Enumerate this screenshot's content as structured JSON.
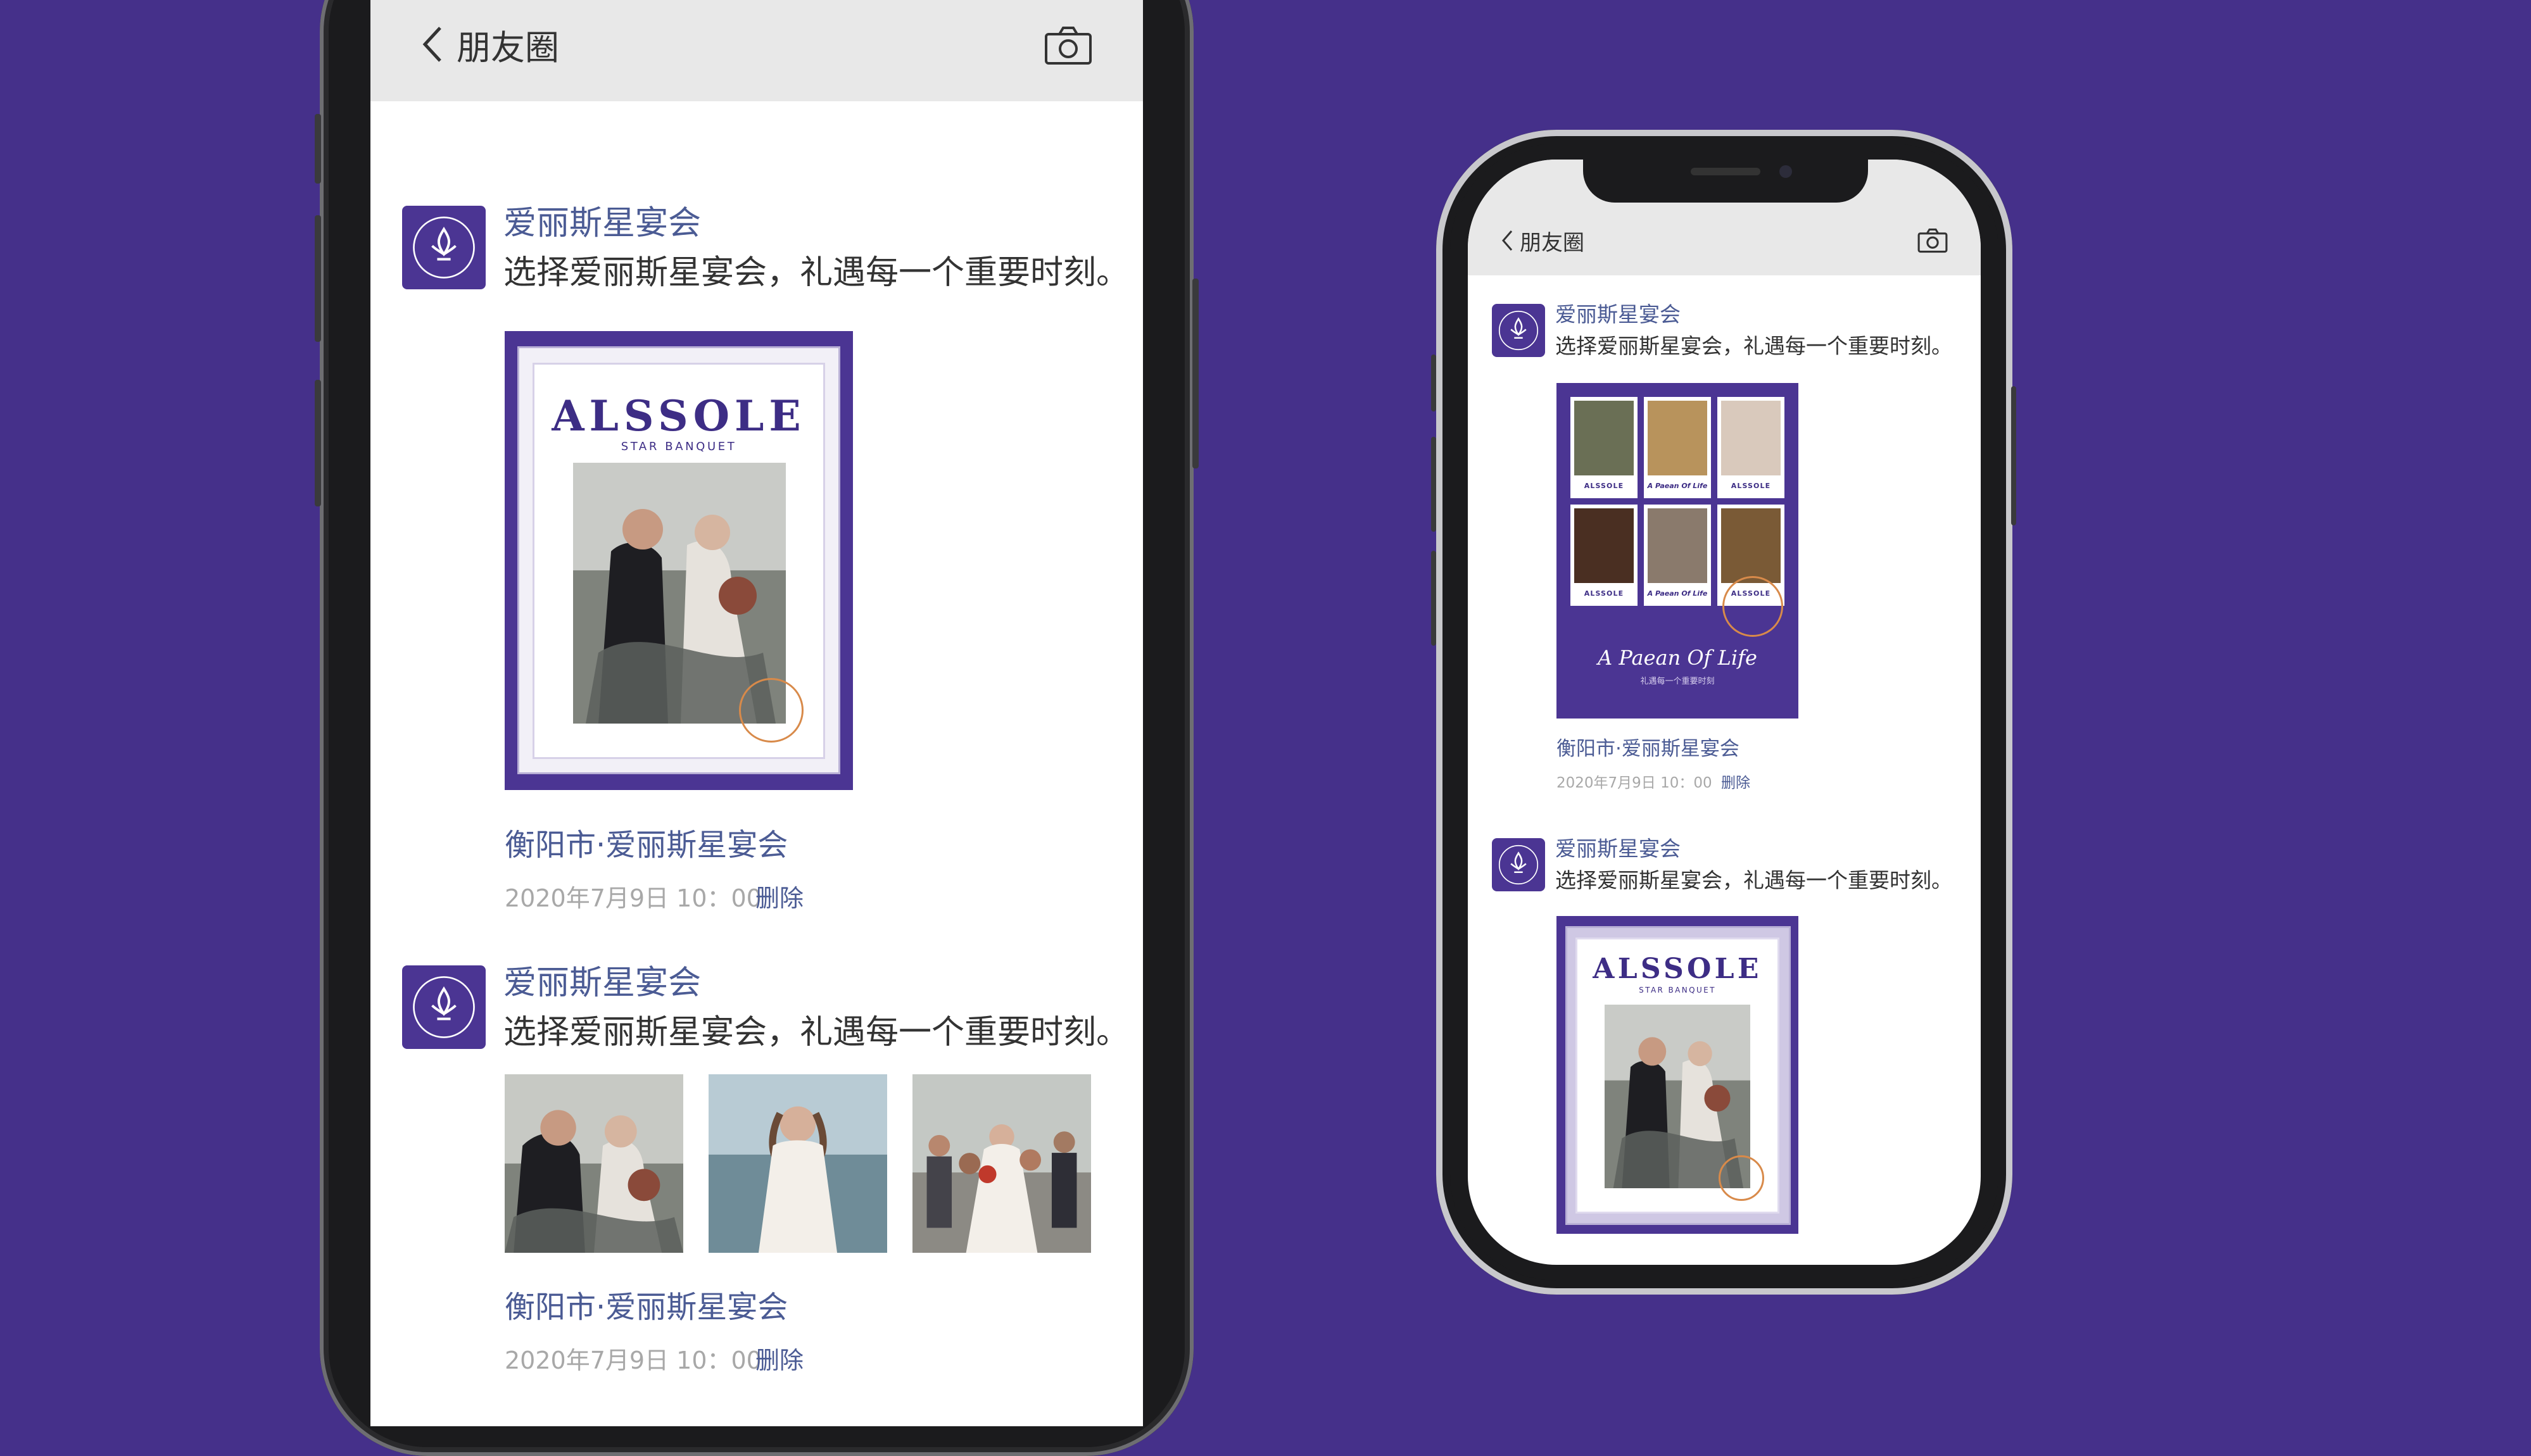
{
  "colors": {
    "background": "#45308a",
    "brand_purple": "#4b3593",
    "link_blue": "#4b5b94",
    "nav_bg": "#e8e8e8"
  },
  "nav": {
    "title": "朋友圈",
    "back_icon": "chevron-left-icon",
    "camera_icon": "camera-icon"
  },
  "posts": [
    {
      "username": "爱丽斯星宴会",
      "text": "选择爱丽斯星宴会，礼遇每一个重要时刻。",
      "location": "衡阳市·爱丽斯星宴会",
      "time": "2020年7月9日 10：00",
      "delete_label": "删除"
    },
    {
      "username": "爱丽斯星宴会",
      "text": "选择爱丽斯星宴会，礼遇每一个重要时刻。",
      "location": "衡阳市·爱丽斯星宴会",
      "time": "2020年7月9日 10：00",
      "delete_label": "删除"
    }
  ],
  "poster": {
    "brand": "ALSSOLE",
    "brand_sub": "STAR BANQUET",
    "script_title": "A Paean Of Life",
    "tagline": "礼遇每一个重要时刻",
    "collage_captions": [
      "ALSSOLE",
      "A Paean Of Life",
      "ALSSOLE",
      "ALSSOLE",
      "A Paean Of Life",
      "ALSSOLE"
    ]
  }
}
